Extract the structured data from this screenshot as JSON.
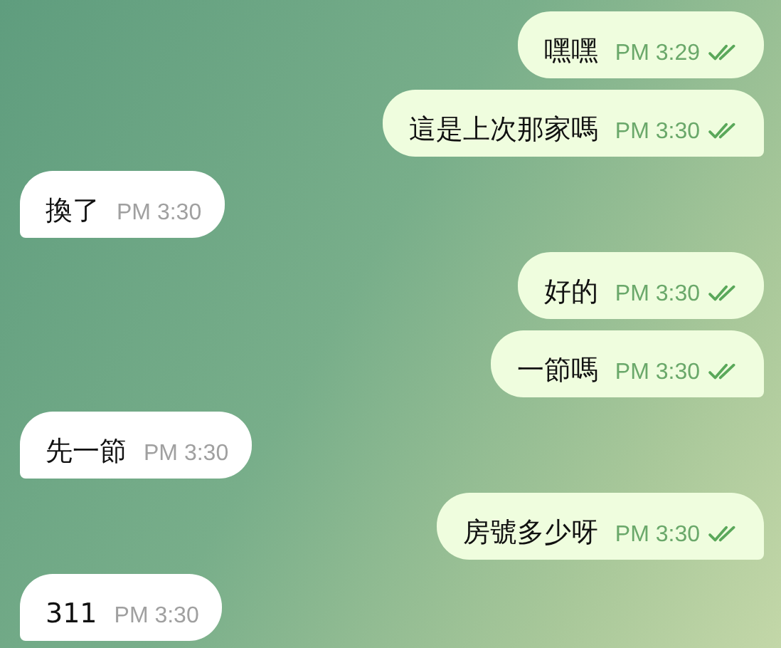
{
  "messages": [
    {
      "outgoing": true,
      "text": "嘿嘿",
      "time": "PM 3:29",
      "read": true
    },
    {
      "outgoing": true,
      "text": "這是上次那家嗎",
      "time": "PM 3:30",
      "read": true
    },
    {
      "outgoing": false,
      "text": "換了",
      "time": "PM 3:30"
    },
    {
      "outgoing": true,
      "text": "好的",
      "time": "PM 3:30",
      "read": true
    },
    {
      "outgoing": true,
      "text": "一節嗎",
      "time": "PM 3:30",
      "read": true
    },
    {
      "outgoing": false,
      "text": "先一節",
      "time": "PM 3:30"
    },
    {
      "outgoing": true,
      "text": "房號多少呀",
      "time": "PM 3:30",
      "read": true
    },
    {
      "outgoing": false,
      "text": "311",
      "time": "PM 3:30"
    }
  ]
}
